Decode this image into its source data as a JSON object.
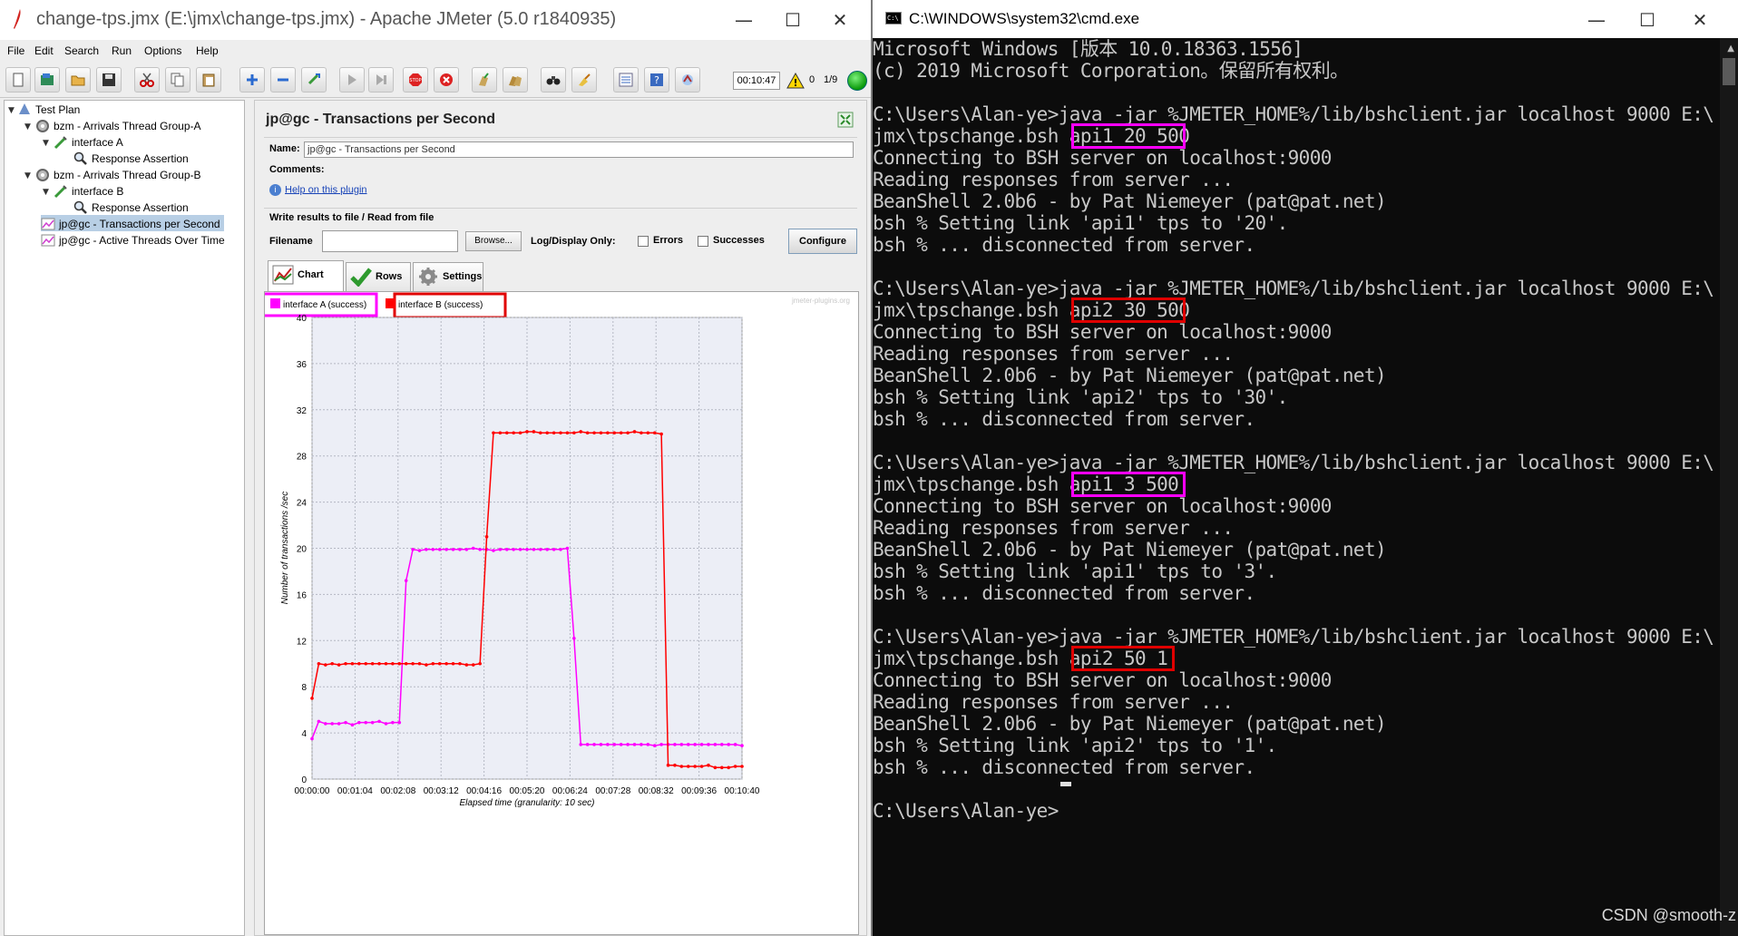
{
  "jmeter": {
    "title": "change-tps.jmx (E:\\jmx\\change-tps.jmx) - Apache JMeter (5.0 r1840935)",
    "menu": [
      "File",
      "Edit",
      "Search",
      "Run",
      "Options",
      "Help"
    ],
    "toolbar": {
      "icons": [
        "new-icon",
        "templates-icon",
        "open-icon",
        "save-icon",
        "cut-icon",
        "copy-icon",
        "paste-icon",
        "expand-icon",
        "collapse-icon",
        "toggle-icon",
        "start-icon",
        "start-no-pause-icon",
        "stop-icon",
        "shutdown-icon",
        "clear-icon",
        "clear-all-icon",
        "search-icon",
        "reset-search-icon",
        "function-helper-icon",
        "help-icon",
        "remote-icon"
      ],
      "timer": "00:10:47",
      "warning_count": "0",
      "threads": "1/9"
    },
    "tree": [
      {
        "label": "Test Plan",
        "icon": "test-plan-icon"
      },
      {
        "label": "bzm - Arrivals Thread Group-A",
        "icon": "thread-group-icon"
      },
      {
        "label": "interface A",
        "icon": "sampler-icon"
      },
      {
        "label": "Response Assertion",
        "icon": "assertion-icon"
      },
      {
        "label": "bzm - Arrivals Thread Group-B",
        "icon": "thread-group-icon"
      },
      {
        "label": "interface B",
        "icon": "sampler-icon"
      },
      {
        "label": "Response Assertion",
        "icon": "assertion-icon"
      },
      {
        "label": "jp@gc - Transactions per Second",
        "icon": "listener-icon"
      },
      {
        "label": "jp@gc - Active Threads Over Time",
        "icon": "listener-icon"
      }
    ],
    "panel": {
      "title": "jp@gc - Transactions per Second",
      "name_label": "Name:",
      "name_value": "jp@gc - Transactions per Second",
      "comments_label": "Comments:",
      "help_link": "Help on this plugin",
      "write_results_title": "Write results to file / Read from file",
      "filename_label": "Filename",
      "browse_label": "Browse...",
      "log_display_label": "Log/Display Only:",
      "errors_label": "Errors",
      "successes_label": "Successes",
      "configure_label": "Configure",
      "tabs": [
        "Chart",
        "Rows",
        "Settings"
      ]
    },
    "chart_watermark": "jmeter-plugins.org"
  },
  "chart_data": {
    "type": "line",
    "ylabel": "Number of transactions /sec",
    "xlabel": "Elapsed time (granularity: 10 sec)",
    "ylim": [
      0,
      40
    ],
    "yticks": [
      "0",
      "4",
      "8",
      "12",
      "16",
      "20",
      "24",
      "28",
      "32",
      "36",
      "40"
    ],
    "xticks": [
      "00:00:00",
      "00:01:04",
      "00:02:08",
      "00:03:12",
      "00:04:16",
      "00:05:20",
      "00:06:24",
      "00:07:28",
      "00:08:32",
      "00:09:36",
      "00:10:40"
    ],
    "xlim_seconds": [
      0,
      640
    ],
    "grid": true,
    "legend_position": "top",
    "series": [
      {
        "name": "interface A (success)",
        "color": "#ff00ff",
        "x": [
          0,
          10,
          20,
          30,
          40,
          50,
          60,
          70,
          80,
          90,
          100,
          110,
          120,
          130,
          140,
          150,
          160,
          170,
          180,
          190,
          200,
          210,
          220,
          230,
          240,
          250,
          260,
          270,
          280,
          290,
          300,
          310,
          320,
          330,
          340,
          350,
          360,
          370,
          380,
          390,
          400,
          410,
          420,
          430,
          440,
          450,
          460,
          470,
          480,
          490,
          500,
          510,
          520,
          530,
          540,
          550,
          560,
          570,
          580,
          590,
          600,
          610,
          620,
          630,
          640
        ],
        "y": [
          3.5,
          5,
          4.8,
          4.8,
          4.8,
          4.9,
          4.7,
          4.9,
          4.9,
          4.9,
          5,
          4.8,
          4.9,
          4.9,
          17.2,
          19.9,
          19.8,
          19.9,
          19.9,
          19.9,
          19.9,
          19.9,
          19.9,
          19.9,
          20,
          19.9,
          19.9,
          19.8,
          19.9,
          19.9,
          19.9,
          19.9,
          19.9,
          19.9,
          19.9,
          19.9,
          19.9,
          19.9,
          20,
          12.2,
          3,
          3,
          3,
          3,
          3,
          3,
          3,
          3,
          3,
          3,
          3,
          2.9,
          3,
          3,
          3,
          3,
          3,
          3,
          3,
          3,
          3,
          3,
          3,
          3,
          2.9
        ]
      },
      {
        "name": "interface B (success)",
        "color": "#ff0000",
        "x": [
          0,
          10,
          20,
          30,
          40,
          50,
          60,
          70,
          80,
          90,
          100,
          110,
          120,
          130,
          140,
          150,
          160,
          170,
          180,
          190,
          200,
          210,
          220,
          230,
          240,
          250,
          260,
          270,
          280,
          290,
          300,
          310,
          320,
          330,
          340,
          350,
          360,
          370,
          380,
          390,
          400,
          410,
          420,
          430,
          440,
          450,
          460,
          470,
          480,
          490,
          500,
          510,
          520,
          530,
          540,
          550,
          560,
          570,
          580,
          590,
          600,
          610,
          620,
          630,
          640
        ],
        "y": [
          7,
          10,
          9.9,
          10,
          9.9,
          10,
          10,
          10,
          10,
          10,
          10,
          10,
          10,
          10,
          10,
          10,
          10,
          9.9,
          10,
          10,
          10,
          10,
          10,
          9.9,
          9.9,
          10,
          21,
          30,
          30,
          30,
          30,
          30,
          30.1,
          30.1,
          30,
          30,
          30,
          30,
          30,
          30,
          30.1,
          30,
          30,
          30,
          30,
          30,
          30,
          30,
          30.1,
          30,
          30,
          30,
          29.9,
          1.2,
          1.2,
          1.1,
          1.1,
          1.1,
          1.1,
          1.2,
          1,
          1,
          1,
          1.1,
          1.1
        ]
      }
    ]
  },
  "cmd": {
    "title": "C:\\WINDOWS\\system32\\cmd.exe",
    "lines": [
      "Microsoft Windows [版本 10.0.18363.1556]",
      "(c) 2019 Microsoft Corporation。保留所有权利。",
      "",
      "C:\\Users\\Alan-ye>java -jar %JMETER_HOME%/lib/bshclient.jar localhost 9000 E:\\",
      "jmx\\tpschange.bsh api1 20 500",
      "Connecting to BSH server on localhost:9000",
      "Reading responses from server ...",
      "BeanShell 2.0b6 - by Pat Niemeyer (pat@pat.net)",
      "bsh % Setting link 'api1' tps to '20'.",
      "bsh % ... disconnected from server.",
      "",
      "C:\\Users\\Alan-ye>java -jar %JMETER_HOME%/lib/bshclient.jar localhost 9000 E:\\",
      "jmx\\tpschange.bsh api2 30 500",
      "Connecting to BSH server on localhost:9000",
      "Reading responses from server ...",
      "BeanShell 2.0b6 - by Pat Niemeyer (pat@pat.net)",
      "bsh % Setting link 'api2' tps to '30'.",
      "bsh % ... disconnected from server.",
      "",
      "C:\\Users\\Alan-ye>java -jar %JMETER_HOME%/lib/bshclient.jar localhost 9000 E:\\",
      "jmx\\tpschange.bsh api1 3 500",
      "Connecting to BSH server on localhost:9000",
      "Reading responses from server ...",
      "BeanShell 2.0b6 - by Pat Niemeyer (pat@pat.net)",
      "bsh % Setting link 'api1' tps to '3'.",
      "bsh % ... disconnected from server.",
      "",
      "C:\\Users\\Alan-ye>java -jar %JMETER_HOME%/lib/bshclient.jar localhost 9000 E:\\",
      "jmx\\tpschange.bsh api2 50 1",
      "Connecting to BSH server on localhost:9000",
      "Reading responses from server ...",
      "BeanShell 2.0b6 - by Pat Niemeyer (pat@pat.net)",
      "bsh % Setting link 'api2' tps to '1'.",
      "bsh % ... disconnected from server.",
      "",
      "C:\\Users\\Alan-ye>"
    ],
    "highlight_colors": {
      "magenta": "#ff00ff",
      "red": "#e00000"
    },
    "watermark": "CSDN @smooth-z"
  }
}
